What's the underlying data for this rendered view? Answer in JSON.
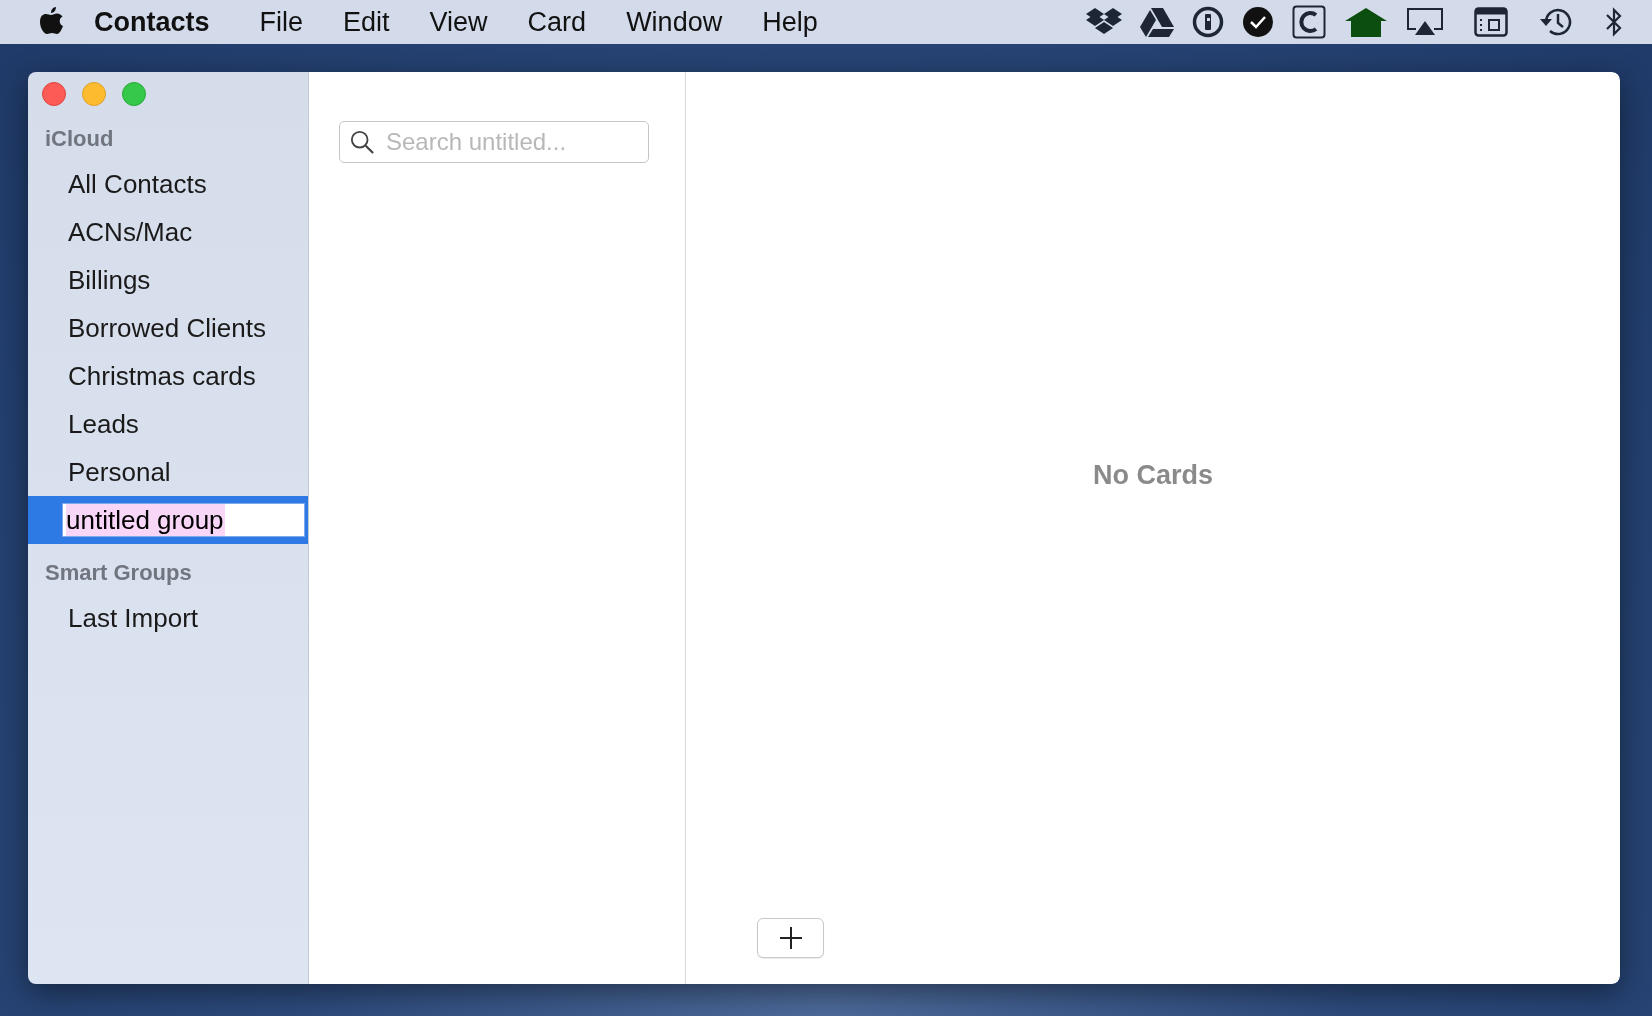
{
  "menu_bar": {
    "app_name": "Contacts",
    "menus": [
      "File",
      "Edit",
      "View",
      "Card",
      "Window",
      "Help"
    ]
  },
  "sidebar": {
    "sections": [
      {
        "title": "iCloud",
        "items": [
          {
            "label": "All Contacts",
            "selected": false,
            "editing": false
          },
          {
            "label": "ACNs/Mac",
            "selected": false,
            "editing": false
          },
          {
            "label": "Billings",
            "selected": false,
            "editing": false
          },
          {
            "label": "Borrowed Clients",
            "selected": false,
            "editing": false
          },
          {
            "label": "Christmas cards",
            "selected": false,
            "editing": false
          },
          {
            "label": "Leads",
            "selected": false,
            "editing": false
          },
          {
            "label": "Personal",
            "selected": false,
            "editing": false
          },
          {
            "label": "untitled group",
            "selected": true,
            "editing": true
          }
        ]
      },
      {
        "title": "Smart Groups",
        "items": [
          {
            "label": "Last Import",
            "selected": false,
            "editing": false
          }
        ]
      }
    ]
  },
  "search": {
    "placeholder": "Search untitled..."
  },
  "card_pane": {
    "empty_message": "No Cards"
  }
}
